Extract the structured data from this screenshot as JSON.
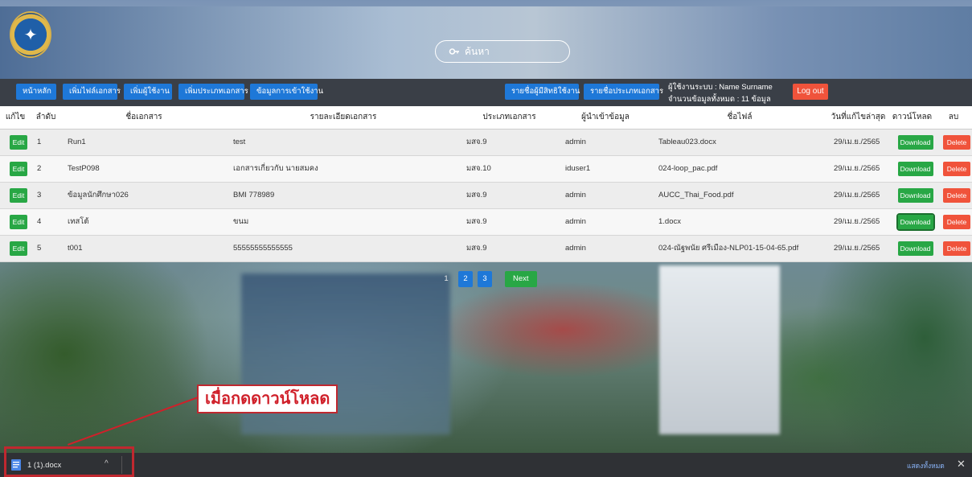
{
  "search": {
    "label": "ค้นหา"
  },
  "nav": {
    "buttons": [
      "หน้าหลัก",
      "เพิ่มไฟล์เอกสาร",
      "เพิ่มผู้ใช้งาน",
      "เพิ่มประเภทเอกสาร",
      "ข้อมูลการเข้าใช้งาน",
      "รายชื่อผู้มีสิทธิใช้งาน",
      "รายชื่อประเภทเอกสาร"
    ],
    "user_line": "ผู้ใช้งานระบบ : Name Surname",
    "count_line": "จำนวนข้อมูลทั้งหมด : 11 ข้อมูล",
    "logout": "Log out"
  },
  "table": {
    "headers": [
      "แก้ไข",
      "ลำดับ",
      "ชื่อเอกสาร",
      "รายละเอียดเอกสาร",
      "ประเภทเอกสาร",
      "ผู้นำเข้าข้อมูล",
      "ชื่อไฟล์",
      "วันที่แก้ไขล่าสุด",
      "ดาวน์โหลด",
      "ลบ"
    ],
    "edit_label": "Edit",
    "download_label": "Download",
    "delete_label": "Delete",
    "rows": [
      {
        "no": "1",
        "name": "Run1",
        "detail": "test",
        "type": "มสจ.9",
        "uploader": "admin",
        "file": "Tableau023.docx",
        "date": "29/เม.ย./2565"
      },
      {
        "no": "2",
        "name": "TestP098",
        "detail": "เอกสารเกี่ยวกับ นายสมคง",
        "type": "มสจ.10",
        "uploader": "iduser1",
        "file": "024-loop_pac.pdf",
        "date": "29/เม.ย./2565"
      },
      {
        "no": "3",
        "name": "ข้อมูลนักศึกษา026",
        "detail": "BMI 778989",
        "type": "มสจ.9",
        "uploader": "admin",
        "file": "AUCC_Thai_Food.pdf",
        "date": "29/เม.ย./2565"
      },
      {
        "no": "4",
        "name": "เทสโต้",
        "detail": "ขนม",
        "type": "มสจ.9",
        "uploader": "admin",
        "file": "1.docx",
        "date": "29/เม.ย./2565"
      },
      {
        "no": "5",
        "name": "t001",
        "detail": "55555555555555",
        "type": "มสจ.9",
        "uploader": "admin",
        "file": "024-ณัฐพนัย ศรีเมือง-NLP01-15-04-65.pdf",
        "date": "29/เม.ย./2565"
      }
    ]
  },
  "pagination": {
    "current": "1",
    "pages": [
      "2",
      "3"
    ],
    "next": "Next"
  },
  "annotation": {
    "label": "เมื่อกดดาวน์โหลด"
  },
  "download_bar": {
    "file": "1 (1).docx",
    "show_all": "แสดงทั้งหมด"
  }
}
